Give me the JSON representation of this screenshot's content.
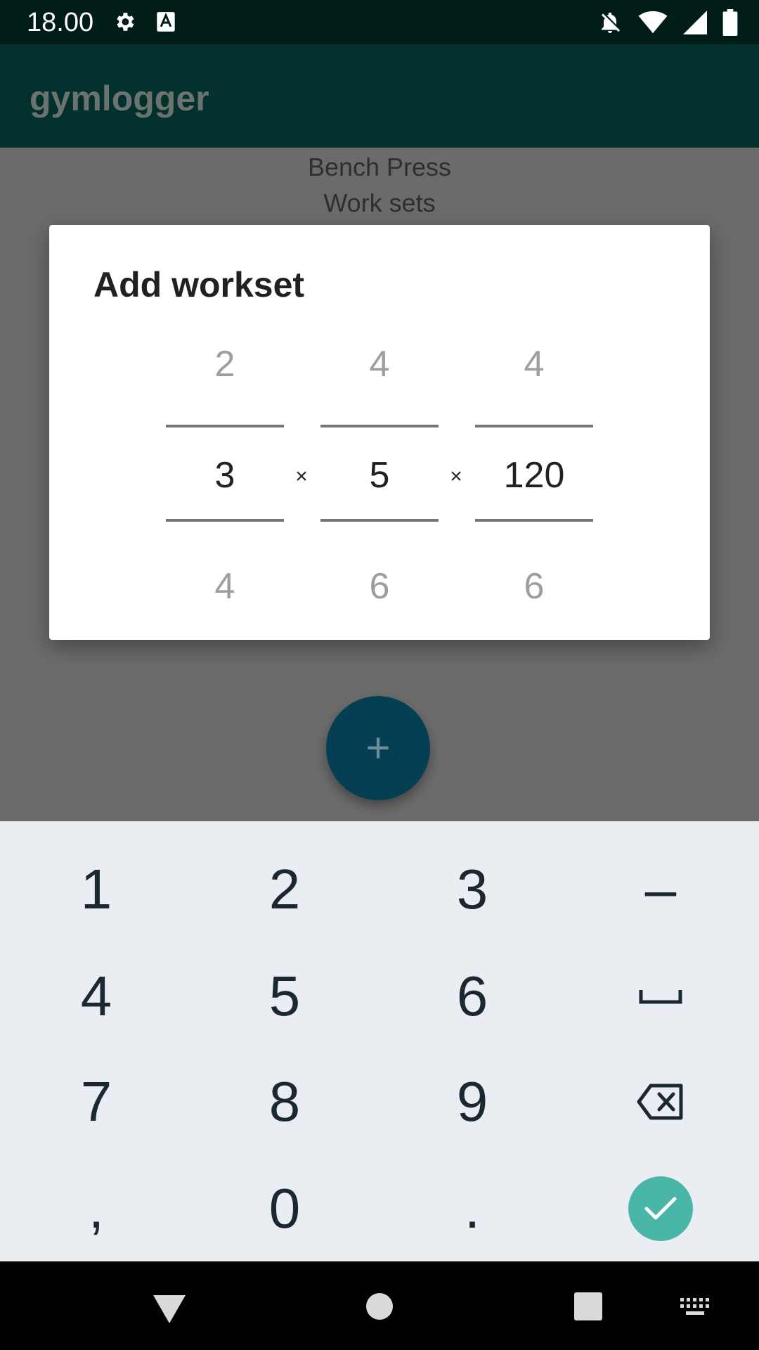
{
  "status_bar": {
    "time": "18.00",
    "icons": [
      "gear-icon",
      "a-badge-icon",
      "notifications-off-icon",
      "wifi-icon",
      "signal-icon",
      "battery-icon"
    ]
  },
  "app_bar": {
    "title": "gymlogger"
  },
  "background": {
    "exercise": "Bench Press",
    "section": "Work sets"
  },
  "dialog": {
    "title": "Add workset",
    "separator": "×",
    "pickers": [
      {
        "previous": "2",
        "current": "3",
        "next": "4"
      },
      {
        "previous": "4",
        "current": "5",
        "next": "6"
      },
      {
        "previous": "4",
        "current": "120",
        "next": "6"
      }
    ]
  },
  "fab": {
    "label": "+"
  },
  "keyboard": {
    "keys": [
      "1",
      "2",
      "3",
      "–",
      "4",
      "5",
      "6",
      "7",
      "8",
      "9",
      ",",
      "0",
      "."
    ],
    "special_keys": [
      "space-key-icon",
      "backspace-icon",
      "confirm-icon"
    ]
  },
  "nav_bar": {
    "icons": [
      "back-icon",
      "home-icon",
      "recents-icon",
      "keyboard-switch-icon"
    ]
  },
  "colors": {
    "status_bar": "#001c19",
    "app_bar": "#02302c",
    "scrim": "#6b6b6b",
    "fab": "#053f53",
    "keyboard_bg": "#eaeef2",
    "confirm_key": "#49b6a8"
  }
}
